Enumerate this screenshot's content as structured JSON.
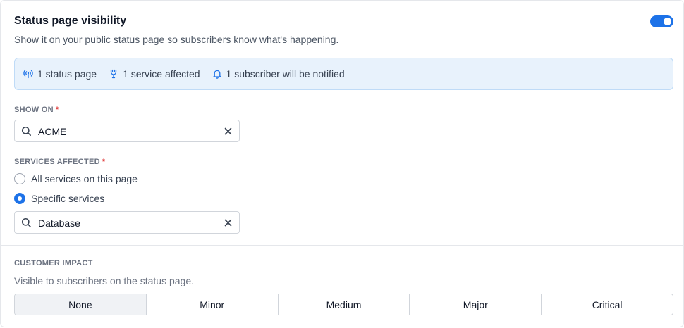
{
  "visibility": {
    "title": "Status page visibility",
    "subtitle": "Show it on your public status page so subscribers know what's happening.",
    "toggle_on": true
  },
  "summary": {
    "items": [
      {
        "icon": "broadcast-icon",
        "label": "1 status page"
      },
      {
        "icon": "service-icon",
        "label": "1 service affected"
      },
      {
        "icon": "bell-icon",
        "label": "1 subscriber will be notified"
      }
    ]
  },
  "show_on": {
    "label": "SHOW ON",
    "required_mark": "*",
    "value": "ACME"
  },
  "services": {
    "label": "SERVICES AFFECTED",
    "required_mark": "*",
    "options": [
      {
        "label": "All services on this page",
        "checked": false
      },
      {
        "label": "Specific services",
        "checked": true
      }
    ],
    "value": "Database"
  },
  "impact": {
    "label": "CUSTOMER IMPACT",
    "description": "Visible to subscribers on the status page.",
    "options": [
      "None",
      "Minor",
      "Medium",
      "Major",
      "Critical"
    ],
    "selected": "None"
  },
  "colors": {
    "accent": "#1d72e8",
    "info_bg": "#e8f2fc",
    "required": "#dc2626"
  }
}
